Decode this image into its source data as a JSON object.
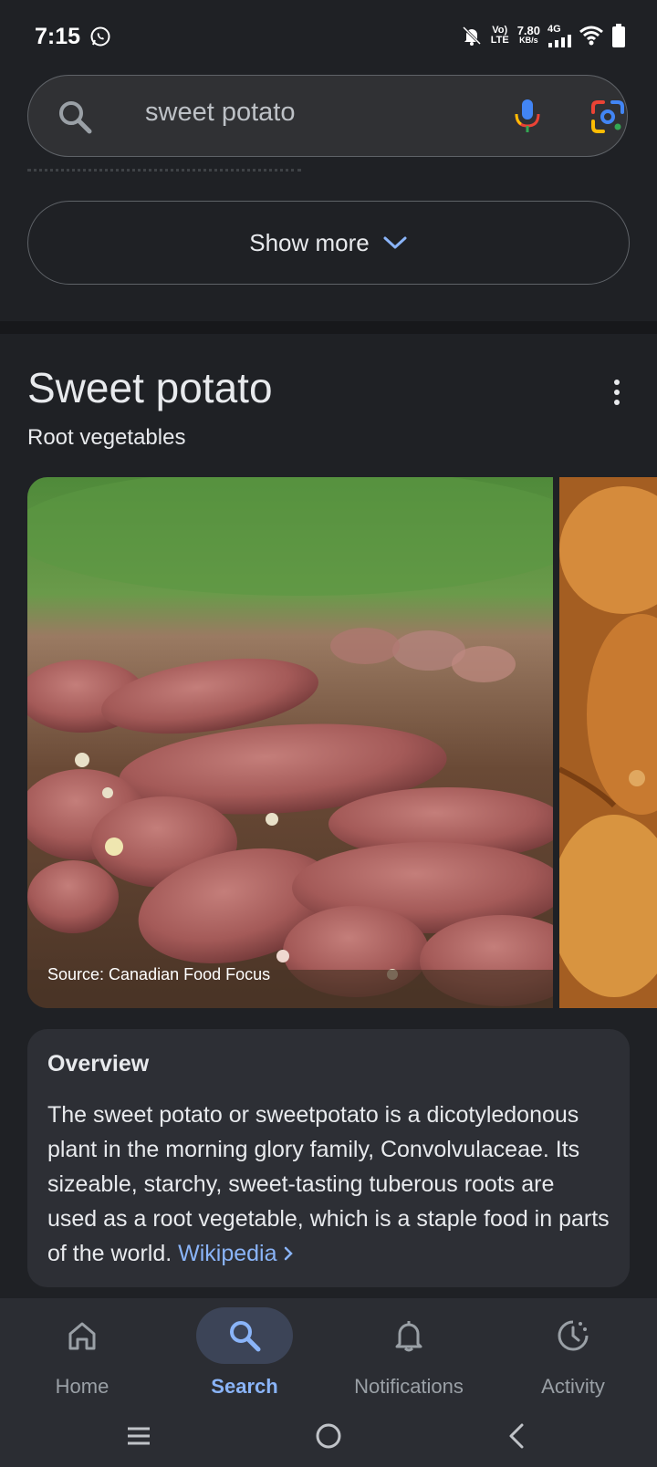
{
  "status_bar": {
    "time": "7:15",
    "volte": "Vo) LTE",
    "speed": "7.80",
    "speed_unit": "KB/s",
    "network": "4G"
  },
  "search": {
    "query": "sweet potato"
  },
  "show_more": {
    "label": "Show more"
  },
  "knowledge_panel": {
    "title": "Sweet potato",
    "subtitle": "Root vegetables",
    "image_source": "Source: Canadian Food Focus"
  },
  "overview": {
    "heading": "Overview",
    "body": "The sweet potato or sweetpotato is a dicotyledonous plant in the morning glory family, Convolvulaceae. Its sizeable, starchy, sweet-tasting tuberous roots are used as a root vegetable, which is a staple food in parts of the world.",
    "link_label": "Wikipedia",
    "link_color": "#8ab4f8"
  },
  "bottom_nav": {
    "items": [
      {
        "label": "Home",
        "icon": "home-icon",
        "active": false
      },
      {
        "label": "Search",
        "icon": "search-icon",
        "active": true
      },
      {
        "label": "Notifications",
        "icon": "bell-icon",
        "active": false
      },
      {
        "label": "Activity",
        "icon": "activity-icon",
        "active": false
      }
    ]
  },
  "colors": {
    "background": "#1f2125",
    "accent": "#8ab4f8",
    "card": "#2d2f35"
  }
}
